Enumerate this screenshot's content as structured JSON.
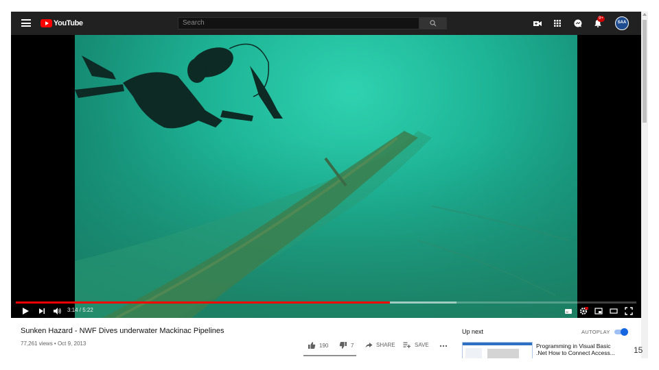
{
  "header": {
    "logo_text": "YouTube",
    "search_placeholder": "Search",
    "notification_badge": "9+",
    "avatar_initials": "SAA"
  },
  "player": {
    "time_display": "3:14 / 5:22",
    "progress_fraction": 0.603,
    "buffer_fraction": 0.71
  },
  "video": {
    "title": "Sunken Hazard - NWF Dives underwater Mackinac Pipelines",
    "meta": "77,261 views • Oct 9, 2013",
    "likes": "190",
    "dislikes": "7",
    "share_label": "SHARE",
    "save_label": "SAVE",
    "like_fraction": 0.964
  },
  "sidebar": {
    "up_next_label": "Up next",
    "autoplay_label": "AUTOPLAY",
    "autoplay_on": true,
    "recommended": [
      {
        "title": "Programming in Visual Basic .Net How to Connect Access..."
      }
    ]
  },
  "slide": {
    "page_number": "15"
  },
  "colors": {
    "topbar": "#212121",
    "accent_red": "#ff0000",
    "water": "#1eb597",
    "toggle_blue": "#1565e0"
  }
}
